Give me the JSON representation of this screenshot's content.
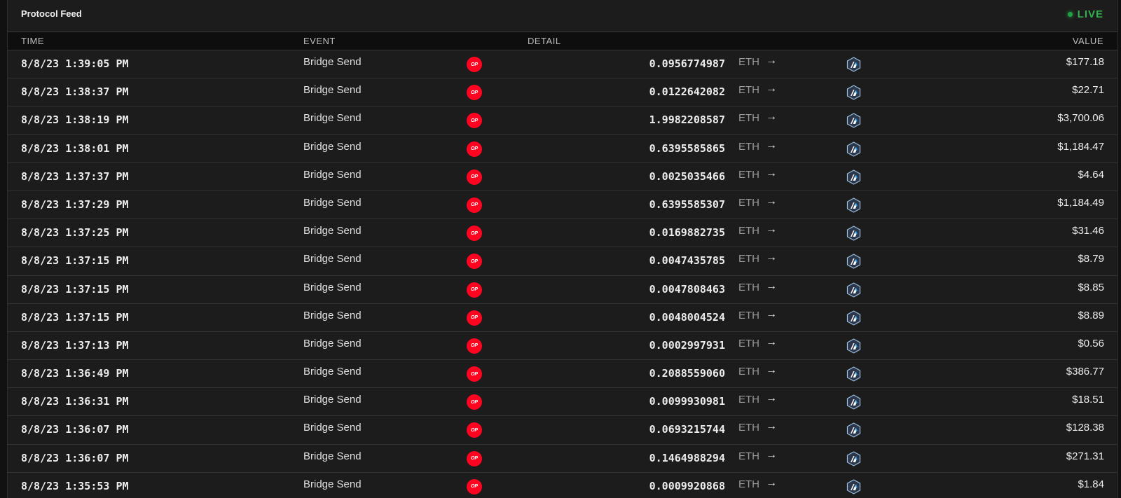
{
  "feed": {
    "title": "Protocol Feed",
    "status": "LIVE"
  },
  "columns": {
    "time": "TIME",
    "event": "EVENT",
    "detail": "DETAIL",
    "value": "VALUE"
  },
  "colors": {
    "background": "#1c1c1c",
    "live": "#2fb24f",
    "optimism": "#ff0420",
    "arbitrum": "#2d374b",
    "arbitrum_accent": "#28a0f0"
  },
  "rows": [
    {
      "time": "8/8/23 1:39:05 PM",
      "event": "Bridge Send",
      "from_chain_icon": "optimism-icon",
      "from_chain_label": "OP",
      "amount": "0.0956774987",
      "token": "ETH",
      "to_chain_icon": "arbitrum-icon",
      "value": "$177.18"
    },
    {
      "time": "8/8/23 1:38:37 PM",
      "event": "Bridge Send",
      "from_chain_icon": "optimism-icon",
      "from_chain_label": "OP",
      "amount": "0.0122642082",
      "token": "ETH",
      "to_chain_icon": "arbitrum-icon",
      "value": "$22.71"
    },
    {
      "time": "8/8/23 1:38:19 PM",
      "event": "Bridge Send",
      "from_chain_icon": "optimism-icon",
      "from_chain_label": "OP",
      "amount": "1.9982208587",
      "token": "ETH",
      "to_chain_icon": "arbitrum-icon",
      "value": "$3,700.06"
    },
    {
      "time": "8/8/23 1:38:01 PM",
      "event": "Bridge Send",
      "from_chain_icon": "optimism-icon",
      "from_chain_label": "OP",
      "amount": "0.6395585865",
      "token": "ETH",
      "to_chain_icon": "arbitrum-icon",
      "value": "$1,184.47"
    },
    {
      "time": "8/8/23 1:37:37 PM",
      "event": "Bridge Send",
      "from_chain_icon": "optimism-icon",
      "from_chain_label": "OP",
      "amount": "0.0025035466",
      "token": "ETH",
      "to_chain_icon": "arbitrum-icon",
      "value": "$4.64"
    },
    {
      "time": "8/8/23 1:37:29 PM",
      "event": "Bridge Send",
      "from_chain_icon": "optimism-icon",
      "from_chain_label": "OP",
      "amount": "0.6395585307",
      "token": "ETH",
      "to_chain_icon": "arbitrum-icon",
      "value": "$1,184.49"
    },
    {
      "time": "8/8/23 1:37:25 PM",
      "event": "Bridge Send",
      "from_chain_icon": "optimism-icon",
      "from_chain_label": "OP",
      "amount": "0.0169882735",
      "token": "ETH",
      "to_chain_icon": "arbitrum-icon",
      "value": "$31.46"
    },
    {
      "time": "8/8/23 1:37:15 PM",
      "event": "Bridge Send",
      "from_chain_icon": "optimism-icon",
      "from_chain_label": "OP",
      "amount": "0.0047435785",
      "token": "ETH",
      "to_chain_icon": "arbitrum-icon",
      "value": "$8.79"
    },
    {
      "time": "8/8/23 1:37:15 PM",
      "event": "Bridge Send",
      "from_chain_icon": "optimism-icon",
      "from_chain_label": "OP",
      "amount": "0.0047808463",
      "token": "ETH",
      "to_chain_icon": "arbitrum-icon",
      "value": "$8.85"
    },
    {
      "time": "8/8/23 1:37:15 PM",
      "event": "Bridge Send",
      "from_chain_icon": "optimism-icon",
      "from_chain_label": "OP",
      "amount": "0.0048004524",
      "token": "ETH",
      "to_chain_icon": "arbitrum-icon",
      "value": "$8.89"
    },
    {
      "time": "8/8/23 1:37:13 PM",
      "event": "Bridge Send",
      "from_chain_icon": "optimism-icon",
      "from_chain_label": "OP",
      "amount": "0.0002997931",
      "token": "ETH",
      "to_chain_icon": "arbitrum-icon",
      "value": "$0.56"
    },
    {
      "time": "8/8/23 1:36:49 PM",
      "event": "Bridge Send",
      "from_chain_icon": "optimism-icon",
      "from_chain_label": "OP",
      "amount": "0.2088559060",
      "token": "ETH",
      "to_chain_icon": "arbitrum-icon",
      "value": "$386.77"
    },
    {
      "time": "8/8/23 1:36:31 PM",
      "event": "Bridge Send",
      "from_chain_icon": "optimism-icon",
      "from_chain_label": "OP",
      "amount": "0.0099930981",
      "token": "ETH",
      "to_chain_icon": "arbitrum-icon",
      "value": "$18.51"
    },
    {
      "time": "8/8/23 1:36:07 PM",
      "event": "Bridge Send",
      "from_chain_icon": "optimism-icon",
      "from_chain_label": "OP",
      "amount": "0.0693215744",
      "token": "ETH",
      "to_chain_icon": "arbitrum-icon",
      "value": "$128.38"
    },
    {
      "time": "8/8/23 1:36:07 PM",
      "event": "Bridge Send",
      "from_chain_icon": "optimism-icon",
      "from_chain_label": "OP",
      "amount": "0.1464988294",
      "token": "ETH",
      "to_chain_icon": "arbitrum-icon",
      "value": "$271.31"
    },
    {
      "time": "8/8/23 1:35:53 PM",
      "event": "Bridge Send",
      "from_chain_icon": "optimism-icon",
      "from_chain_label": "OP",
      "amount": "0.0009920868",
      "token": "ETH",
      "to_chain_icon": "arbitrum-icon",
      "value": "$1.84"
    }
  ]
}
